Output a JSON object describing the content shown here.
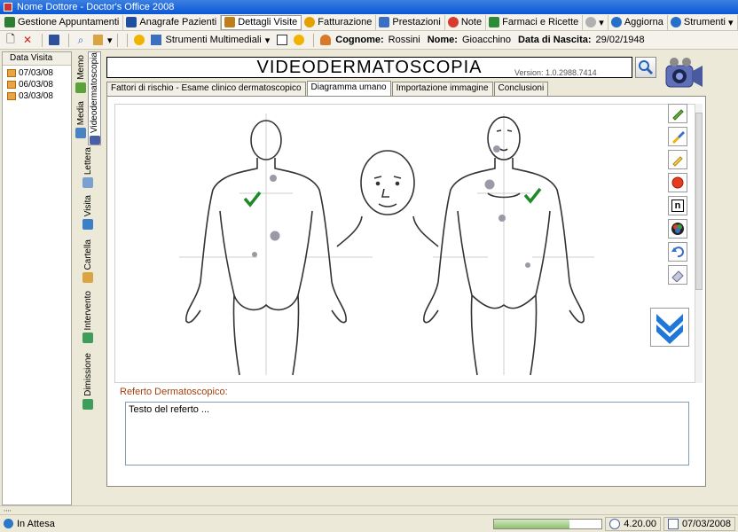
{
  "window": {
    "title": "Nome Dottore - Doctor's Office 2008"
  },
  "menubar": {
    "items": [
      {
        "label": "Gestione Appuntamenti",
        "color": "#2f7d32"
      },
      {
        "label": "Anagrafe Pazienti",
        "color": "#1f4fa0"
      },
      {
        "label": "Dettagli Visite",
        "color": "#c07e1a",
        "active": true
      },
      {
        "label": "Fatturazione",
        "color": "#e3a000"
      },
      {
        "label": "Prestazioni",
        "color": "#3b6fc4"
      },
      {
        "label": "Note",
        "color": "#d83a2b"
      },
      {
        "label": "Farmaci e Ricette",
        "color": "#2d8c3a"
      }
    ],
    "right": [
      {
        "label": "Aggiorna",
        "color": "#2470c8"
      },
      {
        "label": "Strumenti",
        "color": "#2470c8"
      }
    ]
  },
  "toolbar": {
    "multimedia_label": "Strumenti Multimediali",
    "patient": {
      "surname_label": "Cognome:",
      "surname": "Rossini",
      "name_label": "Nome:",
      "name": "Gioacchino",
      "dob_label": "Data di Nascita:",
      "dob": "29/02/1948"
    }
  },
  "visits": {
    "header": "Data Visita",
    "items": [
      "07/03/08",
      "06/03/08",
      "03/03/08"
    ]
  },
  "side_tabs": [
    "Memo",
    "Videodermatoscopia",
    "Media",
    "Lettera",
    "Visita",
    "Cartella",
    "Intervento",
    "Dimissione"
  ],
  "module": {
    "title": "VIDEODERMATOSCOPIA",
    "version": "Version: 1.0.2988.7414"
  },
  "tabs": [
    {
      "label": "Fattori di rischio - Esame clinico dermatoscopico",
      "active": false
    },
    {
      "label": "Diagramma umano",
      "active": true
    },
    {
      "label": "Importazione immagine",
      "active": false
    },
    {
      "label": "Conclusioni",
      "active": false
    }
  ],
  "tools": [
    "pencil-icon",
    "brush-icon",
    "highlighter-icon",
    "circle-marker-icon",
    "text-n-icon",
    "color-palette-icon",
    "undo-icon",
    "eraser-icon"
  ],
  "referto": {
    "label": "Referto Dermatoscopico:",
    "text": "Testo del referto ..."
  },
  "status": {
    "state": "In Attesa",
    "progress": 0.7,
    "time": "4.20.00",
    "date": "07/03/2008"
  }
}
